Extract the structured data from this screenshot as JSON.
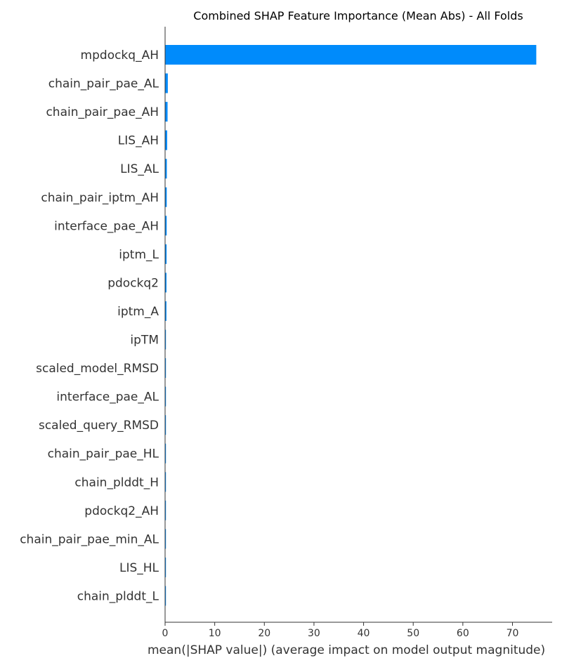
{
  "chart_data": {
    "type": "bar",
    "orientation": "horizontal",
    "title": "Combined SHAP Feature Importance (Mean Abs) - All Folds",
    "xlabel": "mean(|SHAP value|) (average impact on model output magnitude)",
    "ylabel": "",
    "xlim": [
      0,
      78
    ],
    "xticks": [
      0,
      10,
      20,
      30,
      40,
      50,
      60,
      70
    ],
    "grid": false,
    "bar_color": "#008bfb",
    "categories": [
      "mpdockq_AH",
      "chain_pair_pae_AL",
      "chain_pair_pae_AH",
      "LIS_AH",
      "LIS_AL",
      "chain_pair_iptm_AH",
      "interface_pae_AH",
      "iptm_L",
      "pdockq2",
      "iptm_A",
      "ipTM",
      "scaled_model_RMSD",
      "interface_pae_AL",
      "scaled_query_RMSD",
      "chain_pair_pae_HL",
      "chain_plddt_H",
      "pdockq2_AH",
      "chain_pair_pae_min_AL",
      "LIS_HL",
      "chain_plddt_L"
    ],
    "values": [
      74.8,
      0.55,
      0.5,
      0.42,
      0.35,
      0.33,
      0.32,
      0.3,
      0.28,
      0.27,
      0.15,
      0.14,
      0.13,
      0.12,
      0.1,
      0.09,
      0.08,
      0.07,
      0.06,
      0.05
    ]
  }
}
